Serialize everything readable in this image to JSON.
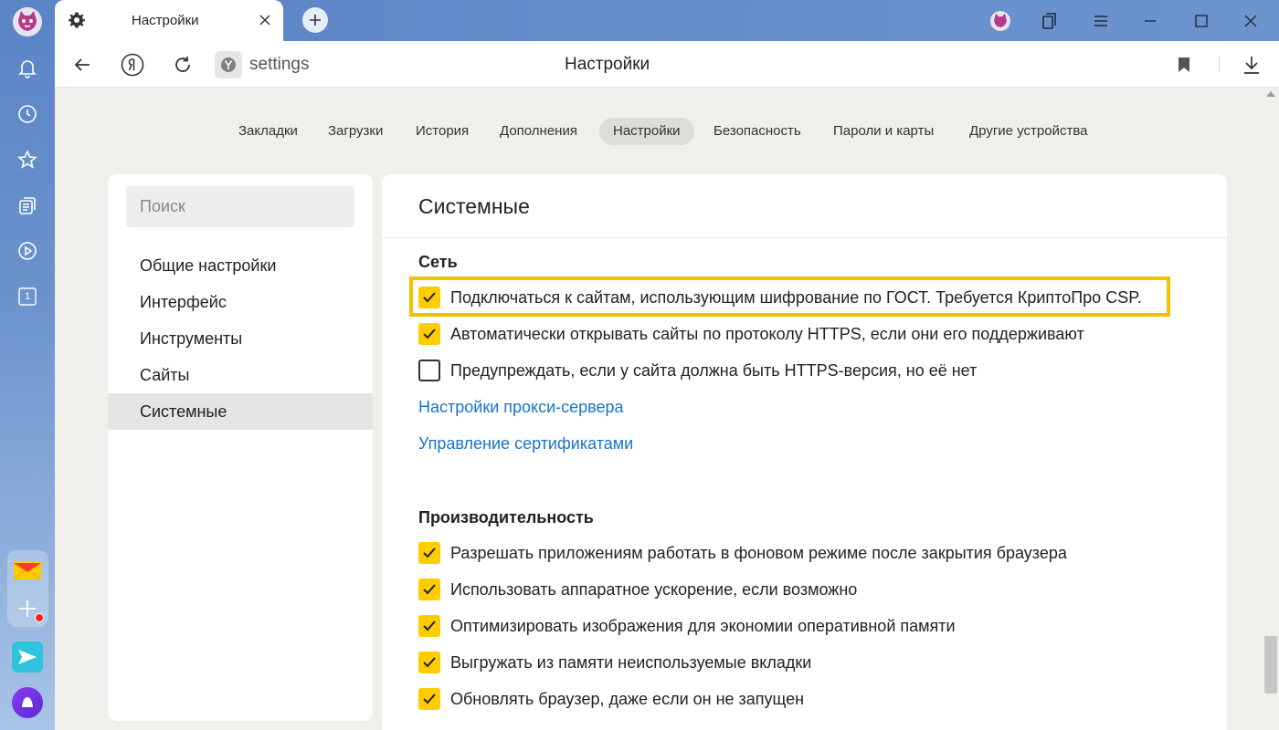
{
  "colors": {
    "accent": "#ffcc00",
    "link": "#1a73c8",
    "highlight": "#f2c300",
    "sidebar": "#5b84c6"
  },
  "tab": {
    "title": "Настройки",
    "icon": "gear-icon"
  },
  "address_bar": {
    "url": "settings",
    "page_title": "Настройки"
  },
  "sidebar_badge": "1",
  "topnav": [
    {
      "label": "Закладки",
      "active": false
    },
    {
      "label": "Загрузки",
      "active": false
    },
    {
      "label": "История",
      "active": false
    },
    {
      "label": "Дополнения",
      "active": false
    },
    {
      "label": "Настройки",
      "active": true
    },
    {
      "label": "Безопасность",
      "active": false
    },
    {
      "label": "Пароли и карты",
      "active": false
    },
    {
      "label": "Другие устройства",
      "active": false
    }
  ],
  "leftpanel": {
    "search_placeholder": "Поиск",
    "items": [
      {
        "label": "Общие настройки",
        "active": false
      },
      {
        "label": "Интерфейс",
        "active": false
      },
      {
        "label": "Инструменты",
        "active": false
      },
      {
        "label": "Сайты",
        "active": false
      },
      {
        "label": "Системные",
        "active": true
      }
    ]
  },
  "main": {
    "title": "Системные",
    "network": {
      "title": "Сеть",
      "options": [
        {
          "label": "Подключаться к сайтам, использующим шифрование по ГОСТ. Требуется КриптоПро CSP.",
          "checked": true,
          "highlighted": true
        },
        {
          "label": "Автоматически открывать сайты по протоколу HTTPS, если они его поддерживают",
          "checked": true
        },
        {
          "label": "Предупреждать, если у сайта должна быть HTTPS-версия, но её нет",
          "checked": false
        }
      ],
      "links": [
        "Настройки прокси-сервера",
        "Управление сертификатами"
      ]
    },
    "performance": {
      "title": "Производительность",
      "options": [
        {
          "label": "Разрешать приложениям работать в фоновом режиме после закрытия браузера",
          "checked": true
        },
        {
          "label": "Использовать аппаратное ускорение, если возможно",
          "checked": true
        },
        {
          "label": "Оптимизировать изображения для экономии оперативной памяти",
          "checked": true
        },
        {
          "label": "Выгружать из памяти неиспользуемые вкладки",
          "checked": true
        },
        {
          "label": "Обновлять браузер, даже если он не запущен",
          "checked": true
        }
      ]
    }
  }
}
